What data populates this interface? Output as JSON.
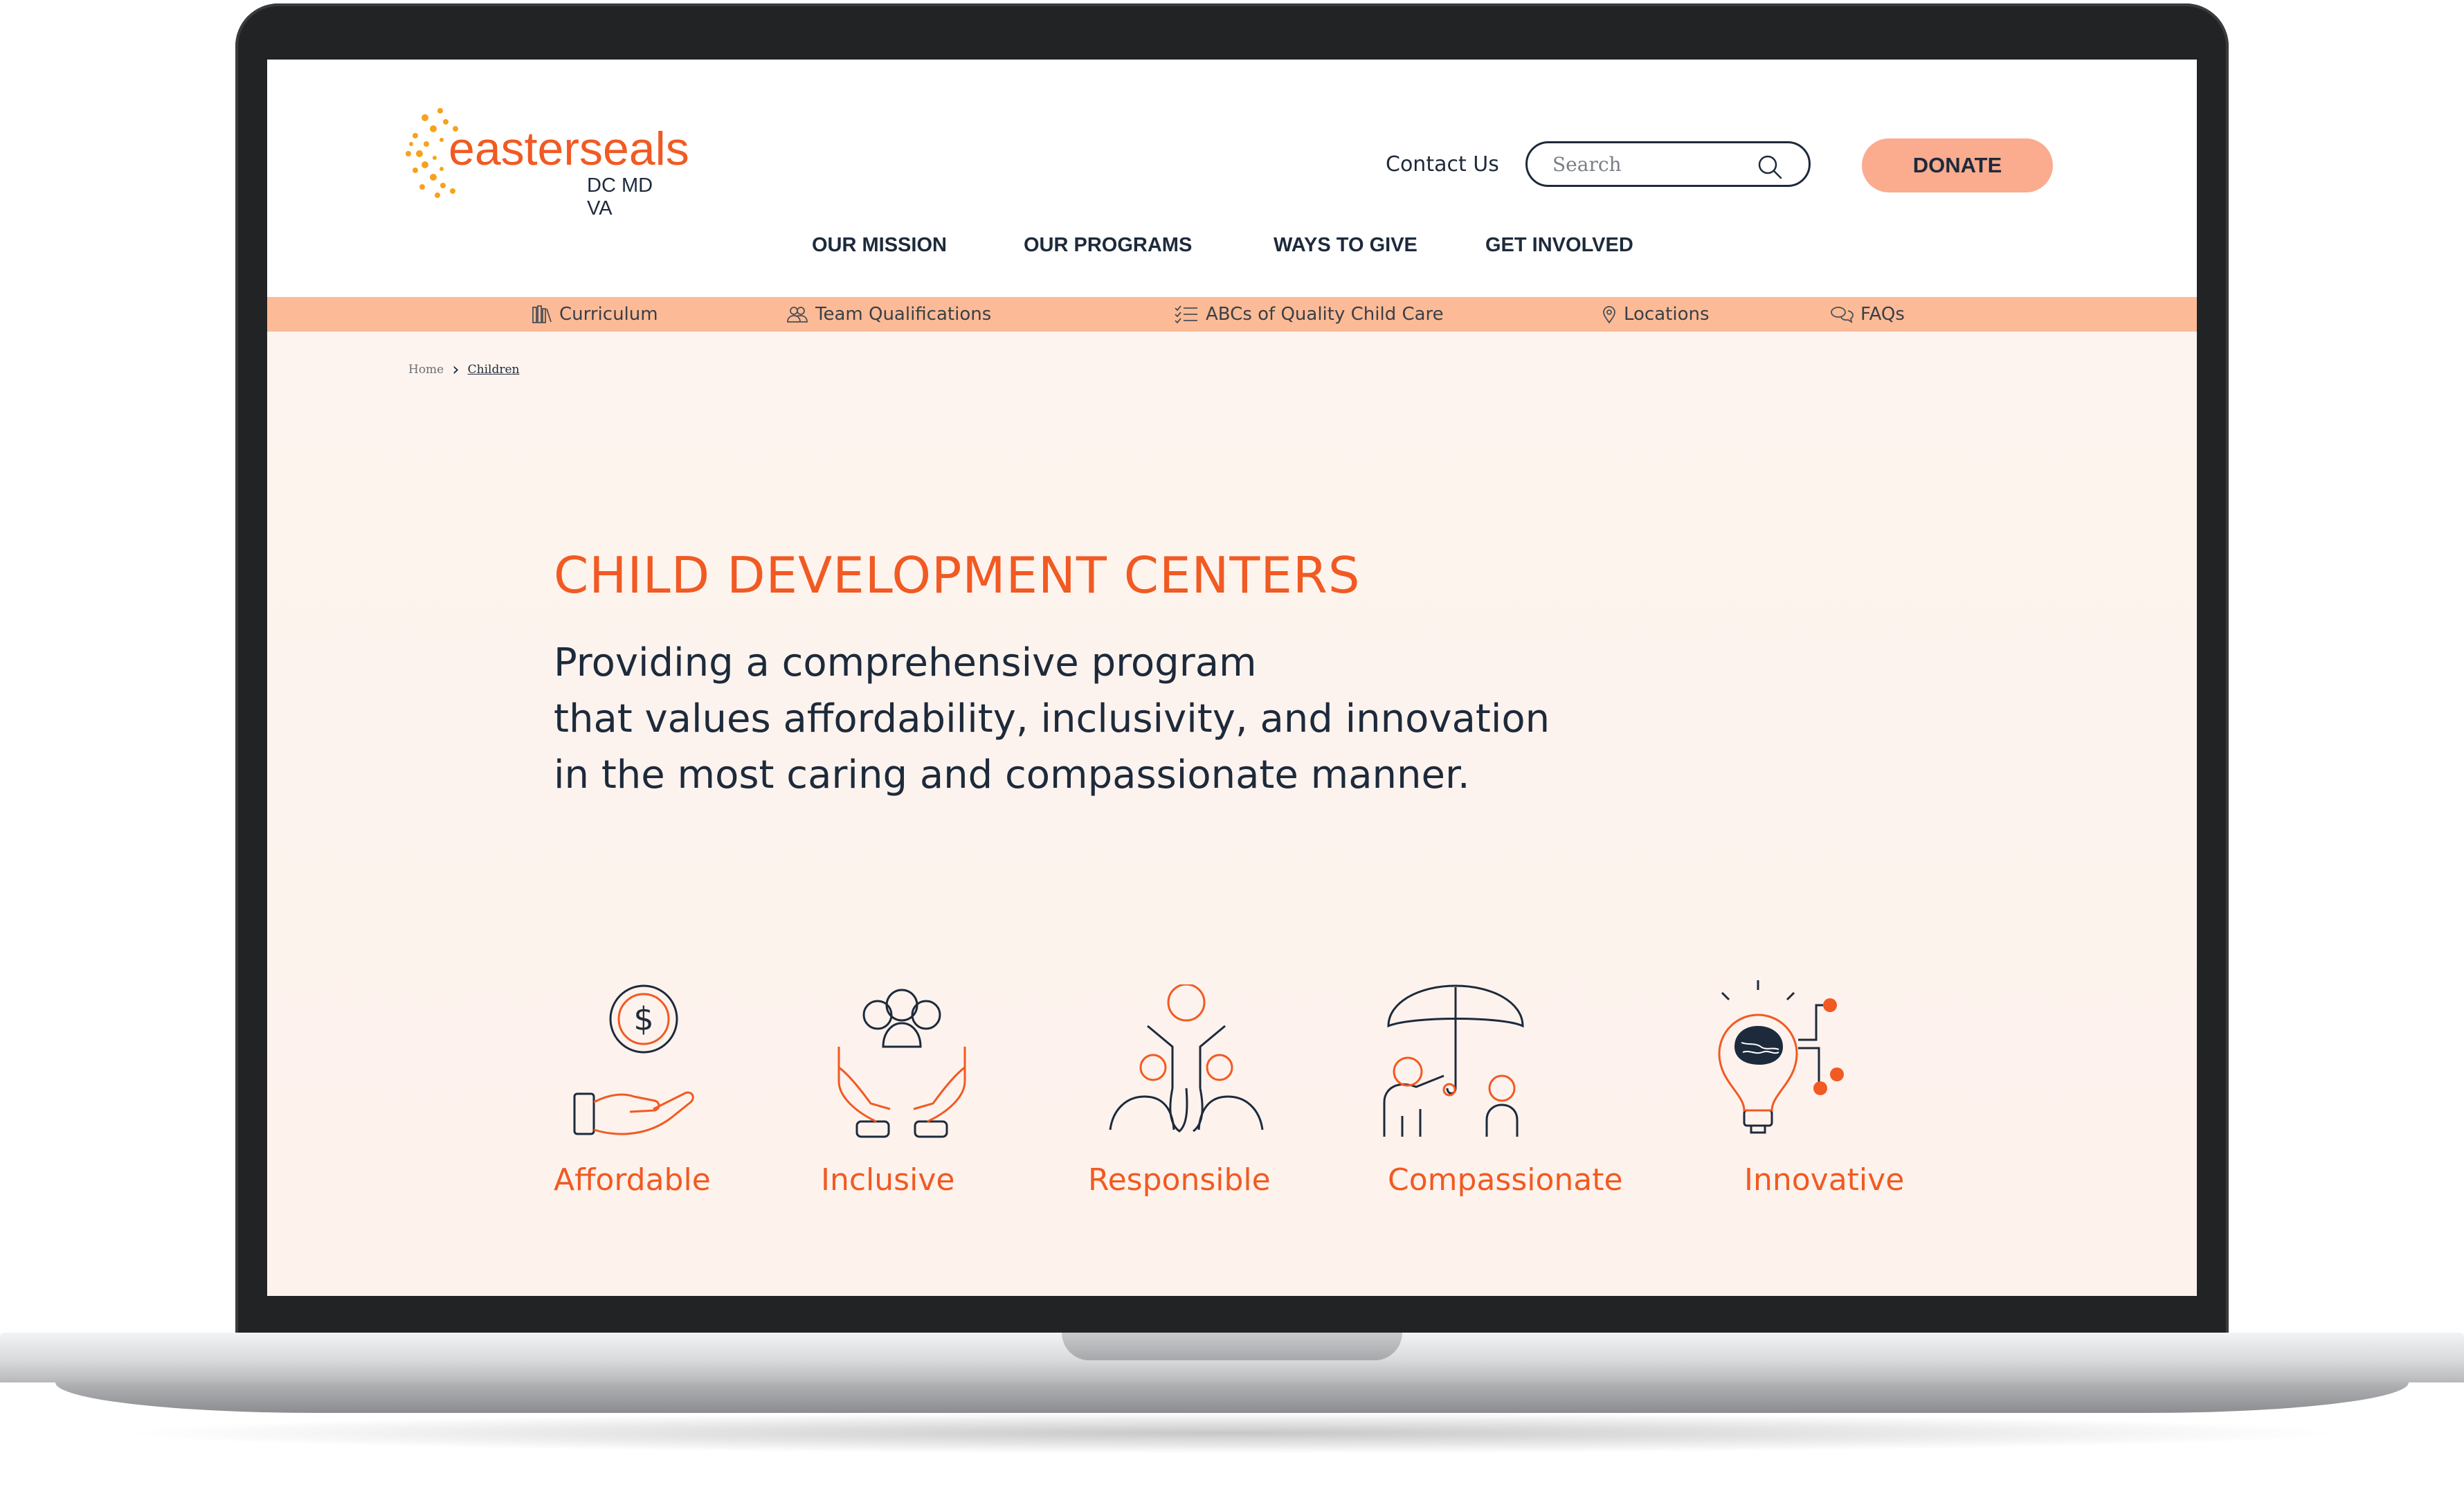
{
  "logo": {
    "wordmark": "easterseals",
    "region": "DC MD VA"
  },
  "header": {
    "contact_label": "Contact Us",
    "search_placeholder": "Search",
    "donate_label": "DONATE"
  },
  "main_nav": [
    {
      "label": "OUR MISSION"
    },
    {
      "label": "OUR PROGRAMS"
    },
    {
      "label": "WAYS TO GIVE"
    },
    {
      "label": "GET INVOLVED"
    }
  ],
  "sub_nav": [
    {
      "label": "Curriculum",
      "icon": "books-icon"
    },
    {
      "label": "Team Qualifications",
      "icon": "people-icon"
    },
    {
      "label": "ABCs of Quality Child Care",
      "icon": "checklist-icon"
    },
    {
      "label": "Locations",
      "icon": "map-pin-icon"
    },
    {
      "label": "FAQs",
      "icon": "chat-bubbles-icon"
    }
  ],
  "breadcrumb": {
    "home": "Home",
    "current": "Children"
  },
  "hero": {
    "title": "CHILD DEVELOPMENT CENTERS",
    "subtitle_lines": [
      "Providing a comprehensive program",
      "that values affordability, inclusivity, and innovation",
      "in the most caring and compassionate manner."
    ]
  },
  "values": [
    {
      "label": "Affordable",
      "icon": "hand-coin-icon"
    },
    {
      "label": "Inclusive",
      "icon": "hands-group-icon"
    },
    {
      "label": "Responsible",
      "icon": "children-group-icon"
    },
    {
      "label": "Compassionate",
      "icon": "umbrella-family-icon"
    },
    {
      "label": "Innovative",
      "icon": "lightbulb-brain-icon"
    }
  ],
  "colors": {
    "brand_orange": "#f15a22",
    "navy": "#1d2a3b",
    "donate_bg": "#fbab8e",
    "subnav_bg": "#fcbb96",
    "hero_bg": "#fdf4ef",
    "logo_burst": "#f7a21b"
  }
}
